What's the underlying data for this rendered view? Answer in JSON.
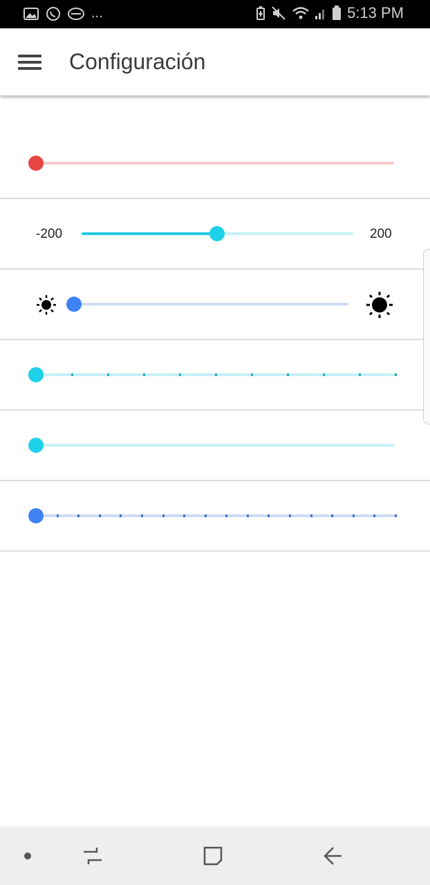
{
  "status_bar": {
    "time": "5:13 PM",
    "left_icons": [
      "image-icon",
      "whatsapp-icon",
      "chat-icon"
    ],
    "more_indicator": "...",
    "right_icons": [
      "battery-saver-icon",
      "mute-icon",
      "wifi-icon",
      "signal-icon",
      "battery-icon"
    ]
  },
  "toolbar": {
    "title": "Configuración",
    "menu_icon": "menu-icon"
  },
  "sliders": [
    {
      "id": "slider-red",
      "color": "#e84545",
      "track_color": "#f6c7cc",
      "value_fraction": 0.0
    },
    {
      "id": "slider-range",
      "color": "#1fd1e8",
      "track_color": "#c5f1f7",
      "min_label": "-200",
      "max_label": "200",
      "value_fraction": 0.5
    },
    {
      "id": "slider-brightness",
      "color": "#3f82f5",
      "track_color": "#cddcf3",
      "min_icon": "brightness-low-icon",
      "max_icon": "brightness-high-icon",
      "value_fraction": 0.0
    },
    {
      "id": "slider-discrete-cyan",
      "color": "#1fd1e8",
      "track_color": "#c5f1f7",
      "tick_color": "#2aa8c4",
      "steps": 10,
      "value_fraction": 0.0
    },
    {
      "id": "slider-plain-cyan",
      "color": "#1fd1e8",
      "track_color": "#c5f1f7",
      "value_fraction": 0.0
    },
    {
      "id": "slider-discrete-blue",
      "color": "#3f82f5",
      "track_color": "#cddcf3",
      "tick_color": "#3f72c9",
      "steps": 17,
      "value_fraction": 0.0
    }
  ],
  "nav_bar": {
    "items": [
      "dot-icon",
      "recents-icon",
      "home-icon",
      "back-icon"
    ]
  }
}
